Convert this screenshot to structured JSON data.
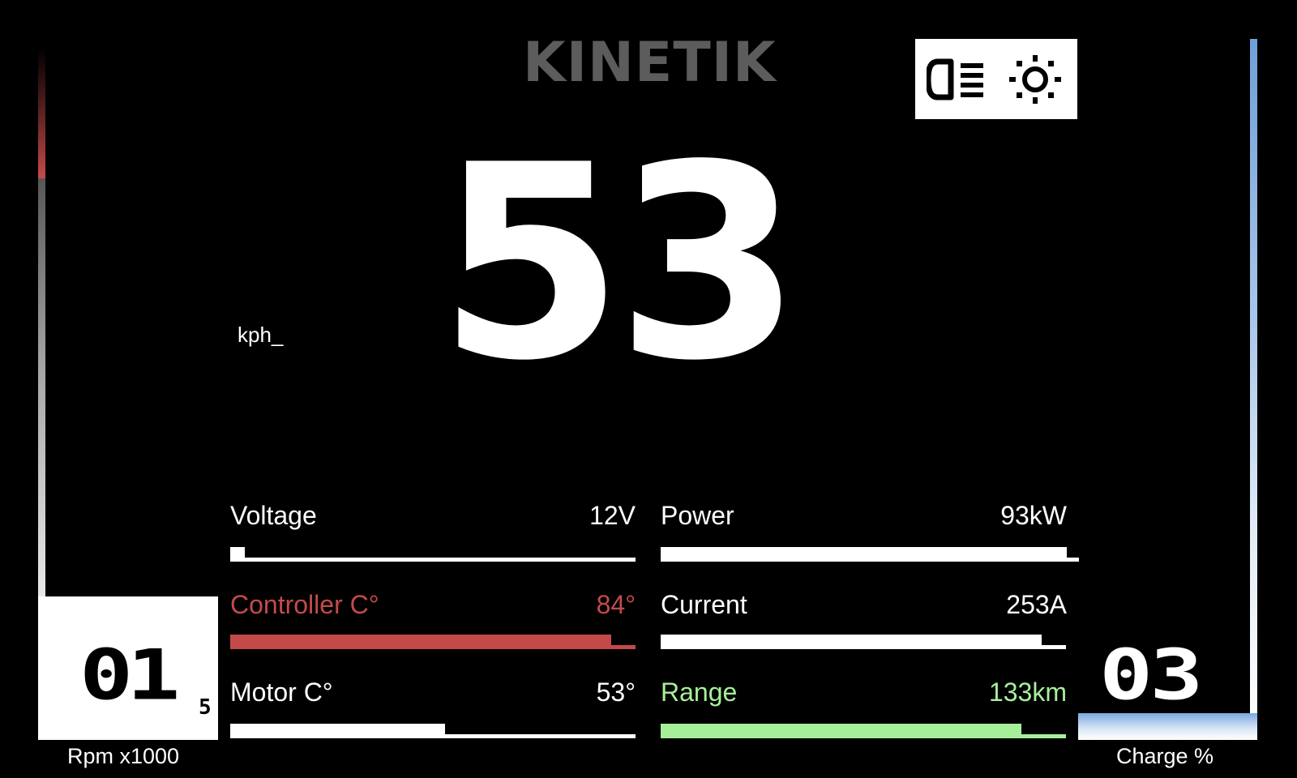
{
  "brand": {
    "logo_text": "KINETIK"
  },
  "speed": {
    "value": "53",
    "unit": "kph_"
  },
  "rpm": {
    "label": "Rpm x1000",
    "value": "01",
    "sub": "5",
    "level": 0.72,
    "redline_color": "#c44a4a"
  },
  "charge": {
    "label": "Charge %",
    "value": "03",
    "level": 0.03,
    "color": "#6fa0d8"
  },
  "icons": {
    "headlight": "headlight-icon",
    "brightness": "brightness-icon"
  },
  "metrics": {
    "voltage": {
      "label": "Voltage",
      "value": "12V",
      "level": 0.03,
      "color": "#ffffff"
    },
    "controller": {
      "label": "Controller C°",
      "value": "84°",
      "level": 0.94,
      "color": "#c44a4a"
    },
    "motor": {
      "label": "Motor C°",
      "value": "53°",
      "level": 0.53,
      "color": "#ffffff"
    },
    "power": {
      "label": "Power",
      "value": "93kW",
      "level": 0.97,
      "color": "#ffffff"
    },
    "current": {
      "label": "Current",
      "value": "253A",
      "level": 0.94,
      "color": "#ffffff"
    },
    "range": {
      "label": "Range",
      "value": "133km",
      "level": 0.89,
      "color": "#a6f09a"
    }
  }
}
